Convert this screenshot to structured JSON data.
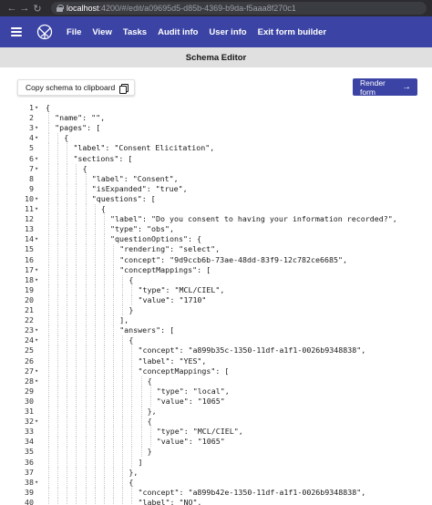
{
  "browser": {
    "url_host": "localhost",
    "url_path": ":4200/#/edit/a09695d5-d85b-4369-b9da-f5aaa8f270c1"
  },
  "header": {
    "menu": [
      "File",
      "View",
      "Tasks",
      "Audit info",
      "User info",
      "Exit form builder"
    ]
  },
  "sub_header": {
    "title": "Schema Editor"
  },
  "toolbar": {
    "copy_label": "Copy schema to clipboard",
    "render_label": "Render form"
  },
  "editor": {
    "lines": [
      {
        "n": "1",
        "fold": "▾",
        "indent": 0,
        "text": "{"
      },
      {
        "n": "2",
        "fold": "",
        "indent": 1,
        "text": "\"name\": \"\","
      },
      {
        "n": "3",
        "fold": "▾",
        "indent": 1,
        "text": "\"pages\": ["
      },
      {
        "n": "4",
        "fold": "▾",
        "indent": 2,
        "text": "{"
      },
      {
        "n": "5",
        "fold": "",
        "indent": 3,
        "text": "\"label\": \"Consent Elicitation\","
      },
      {
        "n": "6",
        "fold": "▾",
        "indent": 3,
        "text": "\"sections\": ["
      },
      {
        "n": "7",
        "fold": "▾",
        "indent": 4,
        "text": "{"
      },
      {
        "n": "8",
        "fold": "",
        "indent": 5,
        "text": "\"label\": \"Consent\","
      },
      {
        "n": "9",
        "fold": "",
        "indent": 5,
        "text": "\"isExpanded\": \"true\","
      },
      {
        "n": "10",
        "fold": "▾",
        "indent": 5,
        "text": "\"questions\": ["
      },
      {
        "n": "11",
        "fold": "▾",
        "indent": 6,
        "text": "{"
      },
      {
        "n": "12",
        "fold": "",
        "indent": 7,
        "text": "\"label\": \"Do you consent to having your information recorded?\","
      },
      {
        "n": "13",
        "fold": "",
        "indent": 7,
        "text": "\"type\": \"obs\","
      },
      {
        "n": "14",
        "fold": "▾",
        "indent": 7,
        "text": "\"questionOptions\": {"
      },
      {
        "n": "15",
        "fold": "",
        "indent": 8,
        "text": "\"rendering\": \"select\","
      },
      {
        "n": "16",
        "fold": "",
        "indent": 8,
        "text": "\"concept\": \"9d9ccb6b-73ae-48dd-83f9-12c782ce6685\","
      },
      {
        "n": "17",
        "fold": "▾",
        "indent": 8,
        "text": "\"conceptMappings\": ["
      },
      {
        "n": "18",
        "fold": "▾",
        "indent": 9,
        "text": "{"
      },
      {
        "n": "19",
        "fold": "",
        "indent": 10,
        "text": "\"type\": \"MCL/CIEL\","
      },
      {
        "n": "20",
        "fold": "",
        "indent": 10,
        "text": "\"value\": \"1710\""
      },
      {
        "n": "21",
        "fold": "",
        "indent": 9,
        "text": "}"
      },
      {
        "n": "22",
        "fold": "",
        "indent": 8,
        "text": "],"
      },
      {
        "n": "23",
        "fold": "▾",
        "indent": 8,
        "text": "\"answers\": ["
      },
      {
        "n": "24",
        "fold": "▾",
        "indent": 9,
        "text": "{"
      },
      {
        "n": "25",
        "fold": "",
        "indent": 10,
        "text": "\"concept\": \"a899b35c-1350-11df-a1f1-0026b9348838\","
      },
      {
        "n": "26",
        "fold": "",
        "indent": 10,
        "text": "\"label\": \"YES\","
      },
      {
        "n": "27",
        "fold": "▾",
        "indent": 10,
        "text": "\"conceptMappings\": ["
      },
      {
        "n": "28",
        "fold": "▾",
        "indent": 11,
        "text": "{"
      },
      {
        "n": "29",
        "fold": "",
        "indent": 12,
        "text": "\"type\": \"local\","
      },
      {
        "n": "30",
        "fold": "",
        "indent": 12,
        "text": "\"value\": \"1065\""
      },
      {
        "n": "31",
        "fold": "",
        "indent": 11,
        "text": "},"
      },
      {
        "n": "32",
        "fold": "▾",
        "indent": 11,
        "text": "{"
      },
      {
        "n": "33",
        "fold": "",
        "indent": 12,
        "text": "\"type\": \"MCL/CIEL\","
      },
      {
        "n": "34",
        "fold": "",
        "indent": 12,
        "text": "\"value\": \"1065\""
      },
      {
        "n": "35",
        "fold": "",
        "indent": 11,
        "text": "}"
      },
      {
        "n": "36",
        "fold": "",
        "indent": 10,
        "text": "]"
      },
      {
        "n": "37",
        "fold": "",
        "indent": 9,
        "text": "},"
      },
      {
        "n": "38",
        "fold": "▾",
        "indent": 9,
        "text": "{"
      },
      {
        "n": "39",
        "fold": "",
        "indent": 10,
        "text": "\"concept\": \"a899b42e-1350-11df-a1f1-0026b9348838\","
      },
      {
        "n": "40",
        "fold": "",
        "indent": 10,
        "text": "\"label\": \"NO\","
      }
    ]
  },
  "colors": {
    "header_bg": "#3b44a4",
    "sub_header_bg": "#e0e0e0",
    "primary_button": "#3b44a4"
  },
  "icons": {
    "copy": "copy-icon",
    "menu": "hamburger-icon",
    "logo": "logo-icon",
    "render_arrow": "arrow-right-icon"
  }
}
